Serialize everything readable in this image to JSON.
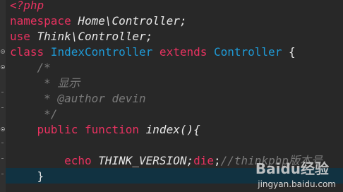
{
  "code_lines": [
    {
      "parts": [
        {
          "t": "<?php",
          "c": "kw italic"
        }
      ]
    },
    {
      "parts": [
        {
          "t": "namespace",
          "c": "kw"
        },
        {
          "t": " Home\\Controller;",
          "c": "italic"
        }
      ]
    },
    {
      "parts": [
        {
          "t": "use",
          "c": "kw"
        },
        {
          "t": " Think\\Controller;",
          "c": "italic"
        }
      ]
    },
    {
      "parts": [
        {
          "t": "class",
          "c": "kw"
        },
        {
          "t": " IndexController",
          "c": "kw-blue"
        },
        {
          "t": " extends",
          "c": "kw"
        },
        {
          "t": " Controller",
          "c": "kw-blue"
        },
        {
          "t": " {",
          "c": ""
        }
      ]
    },
    {
      "parts": [
        {
          "t": "    /*",
          "c": "comment"
        }
      ]
    },
    {
      "parts": [
        {
          "t": "     * 显示",
          "c": "comment"
        }
      ]
    },
    {
      "parts": [
        {
          "t": "     * @author devin",
          "c": "comment"
        }
      ]
    },
    {
      "parts": [
        {
          "t": "     */",
          "c": "comment"
        }
      ]
    },
    {
      "parts": [
        {
          "t": "    public",
          "c": "kw"
        },
        {
          "t": " function",
          "c": "kw"
        },
        {
          "t": " index(){",
          "c": "italic"
        }
      ]
    },
    {
      "parts": [
        {
          "t": "",
          "c": ""
        }
      ]
    },
    {
      "parts": [
        {
          "t": "        echo",
          "c": "kw"
        },
        {
          "t": " THINK_VERSION;",
          "c": "italic"
        },
        {
          "t": "die",
          "c": "kw"
        },
        {
          "t": ";",
          "c": ""
        },
        {
          "t": "//thinkphp版本号",
          "c": "comment"
        }
      ]
    },
    {
      "parts": [
        {
          "t": "    }",
          "c": ""
        }
      ]
    }
  ],
  "watermark": {
    "logo": "Baidu经验",
    "url": "jingyan.baidu.com"
  }
}
